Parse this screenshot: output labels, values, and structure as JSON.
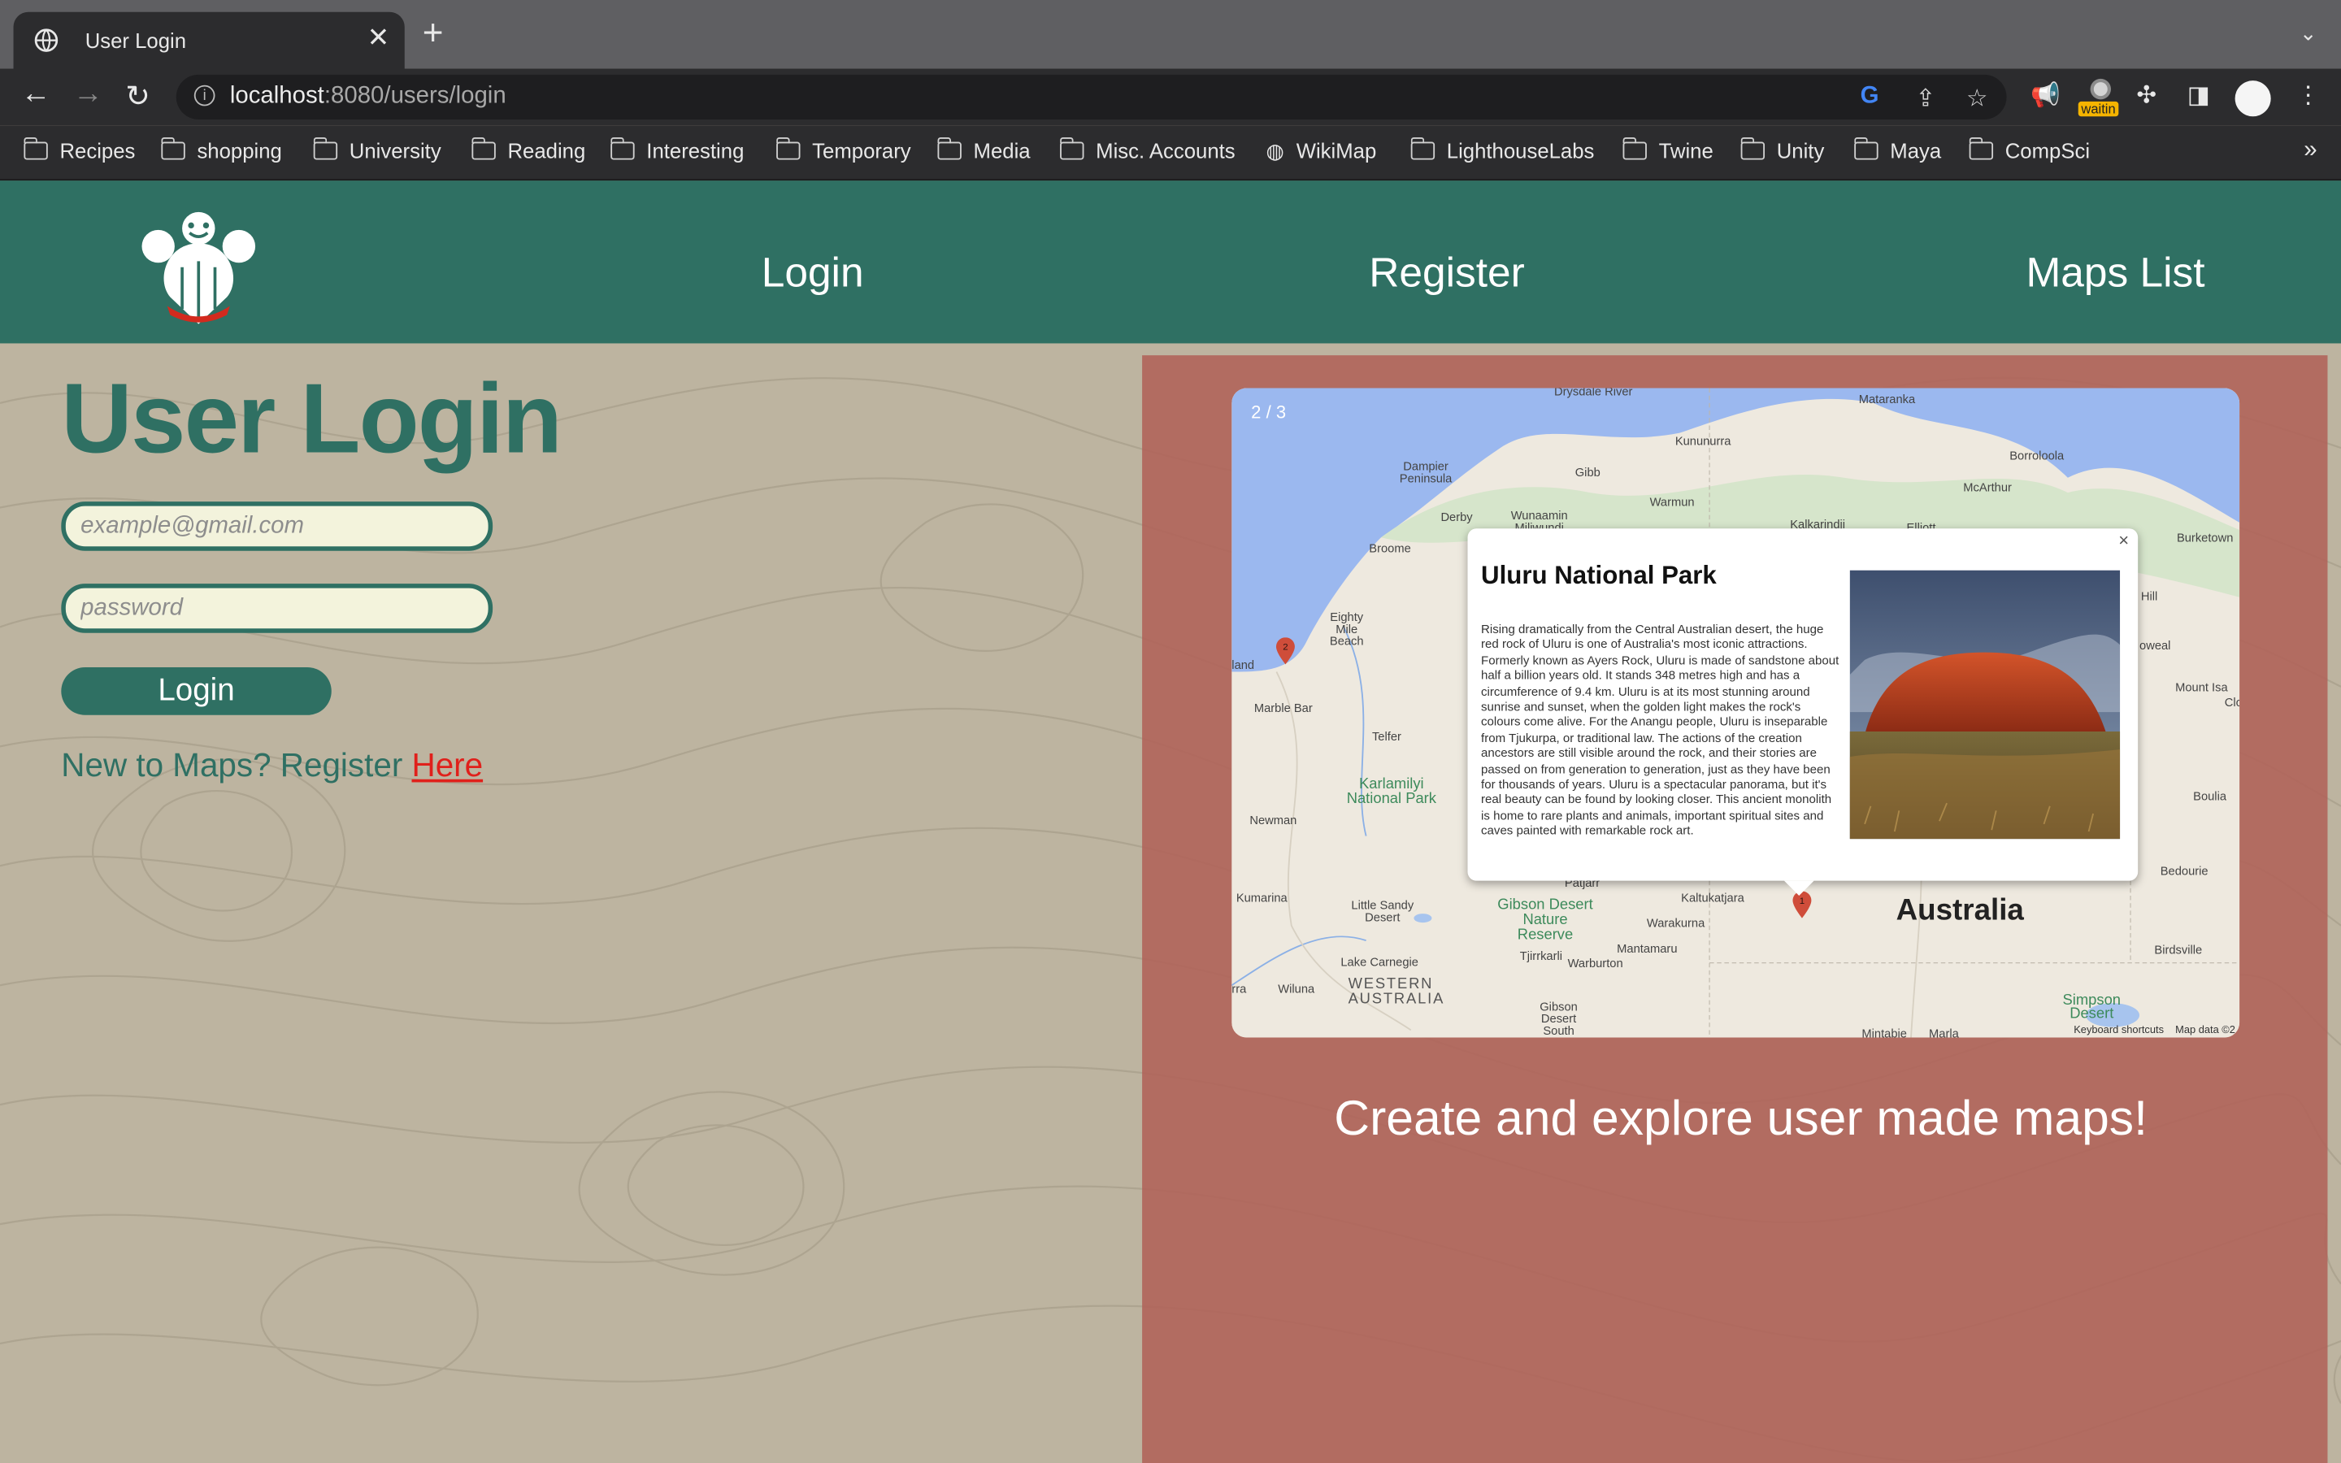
{
  "browser": {
    "tab_title": "User Login",
    "url_host": "localhost",
    "url_rest": ":8080/users/login",
    "extension_badge": "waitin",
    "bookmarks": [
      "Recipes",
      "shopping",
      "University",
      "Reading",
      "Interesting",
      "Temporary",
      "Media",
      "Misc. Accounts",
      "WikiMap",
      "LighthouseLabs",
      "Twine",
      "Unity",
      "Maya",
      "CompSci"
    ]
  },
  "header": {
    "nav": [
      "Login",
      "Register",
      "Maps List"
    ]
  },
  "login": {
    "title": "User Login",
    "email_placeholder": "example@gmail.com",
    "password_placeholder": "password",
    "button": "Login",
    "register_prefix": "New to Maps? Register ",
    "register_link": "Here"
  },
  "showcase": {
    "counter": "2 / 3",
    "tagline": "Create and explore user made maps!",
    "popup_title": "Uluru National Park",
    "popup_text": "Rising dramatically from the Central Australian desert, the huge red rock of Uluru is one of Australia's most iconic attractions. Formerly known as Ayers Rock, Uluru is made of sandstone about half a billion years old. It stands 348 metres high and has a circumference of 9.4 km. Uluru is at its most stunning around sunrise and sunset, when the golden light makes the rock's colours come alive. For the Anangu people, Uluru is inseparable from Tjukurpa, or traditional law. The actions of the creation ancestors are still visible around the rock, and their stories are passed on from generation to generation, just as they have been for thousands of years. Uluru is a spectacular panorama, but it's real beauty can be found by looking closer. This ancient monolith is home to rare plants and animals, important spiritual sites and caves painted with remarkable rock art.",
    "close": "×",
    "markers": [
      "1",
      "2"
    ],
    "map_labels": [
      "Drysdale River",
      "Mataranka",
      "Kununurra",
      "Borroloola",
      "Dampier Peninsula",
      "Gibb",
      "McArthur",
      "Derby",
      "Wunaamin Miliwundi",
      "Warmun",
      "Kalkarindji",
      "Elliott",
      "Burketown",
      "Broome",
      "Hill",
      "Eighty Mile Beach",
      "oweal",
      "Mount Isa",
      "Clo",
      "land",
      "Marble Bar",
      "Telfer",
      "Karlamilyi National Park",
      "Boulia",
      "Newman",
      "Bedourie",
      "Kumarina",
      "Little Sandy Desert",
      "Gibson Desert Nature Reserve",
      "Kaltukatjara",
      "Warakurna",
      "Patjarr",
      "Australia",
      "Birdsville",
      "Tjirrkarli",
      "Mantamaru",
      "Warburton",
      "Lake Carnegie",
      "rra",
      "Wiluna",
      "WESTERN AUSTRALIA",
      "Gibson Desert South",
      "Simpson Desert",
      "Mintabie",
      "Marla",
      "Keyboard shortcuts",
      "Map data ©2"
    ]
  }
}
